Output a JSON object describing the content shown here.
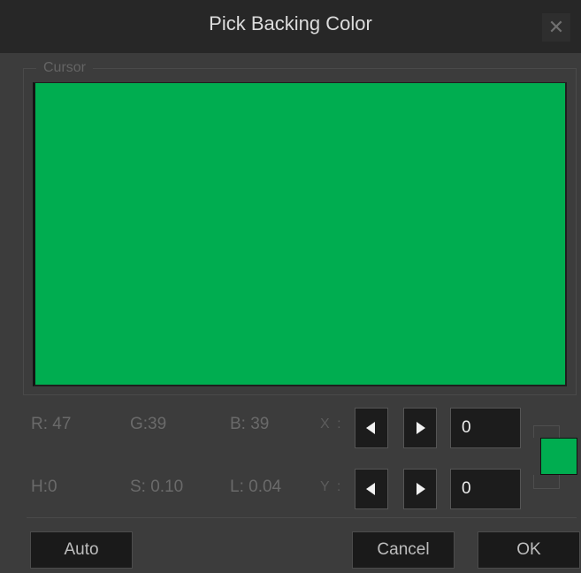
{
  "window": {
    "title": "Pick Backing Color",
    "close_glyph": "✕",
    "close_icon": "close-icon"
  },
  "cursor_group": {
    "label": "Cursor"
  },
  "colors": {
    "picked": "#00ad50",
    "background": "#3c3c3c",
    "titlebar": "#272727"
  },
  "readouts": {
    "r": "R: 47",
    "g": "G:39",
    "b": "B: 39",
    "h": "H:0",
    "s": "S: 0.10",
    "l": "L: 0.04"
  },
  "position": {
    "x_label": "X :",
    "y_label": "Y :",
    "x_value": "0",
    "y_value": "0",
    "decrement_icon": "triangle-left-icon",
    "increment_icon": "triangle-right-icon"
  },
  "buttons": {
    "auto": "Auto",
    "cancel": "Cancel",
    "ok": "OK"
  }
}
